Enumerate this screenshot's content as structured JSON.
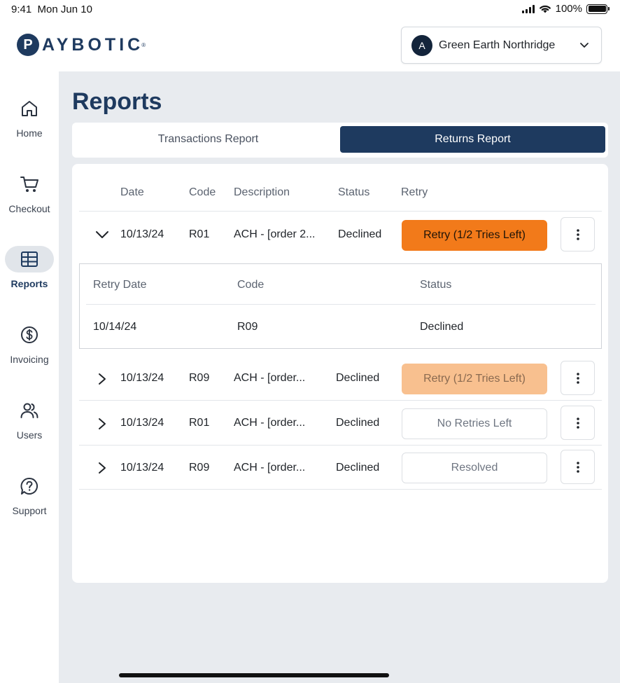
{
  "status_bar": {
    "time": "9:41",
    "date": "Mon Jun 10",
    "battery": "100%"
  },
  "brand": {
    "mark": "P",
    "name": "AYBOTIC",
    "reg": "®"
  },
  "store": {
    "avatar_letter": "A",
    "name": "Green Earth Northridge"
  },
  "sidebar": {
    "items": [
      {
        "label": "Home",
        "icon": "home-icon",
        "active": false
      },
      {
        "label": "Checkout",
        "icon": "cart-icon",
        "active": false
      },
      {
        "label": "Reports",
        "icon": "table-icon",
        "active": true
      },
      {
        "label": "Invoicing",
        "icon": "dollar-circle-icon",
        "active": false
      },
      {
        "label": "Users",
        "icon": "users-icon",
        "active": false
      },
      {
        "label": "Support",
        "icon": "help-bubble-icon",
        "active": false
      }
    ]
  },
  "page": {
    "title": "Reports"
  },
  "tabs": [
    {
      "label": "Transactions Report",
      "active": false
    },
    {
      "label": "Returns Report",
      "active": true
    }
  ],
  "table": {
    "headers": {
      "date": "Date",
      "code": "Code",
      "description": "Description",
      "status": "Status",
      "retry": "Retry"
    },
    "rows": [
      {
        "date": "10/13/24",
        "code": "R01",
        "description": "ACH - [order 2...",
        "status": "Declined",
        "retry": "Retry (1/2 Tries Left)",
        "expanded": true
      },
      {
        "date": "10/13/24",
        "code": "R09",
        "description": "ACH - [order...",
        "status": "Declined",
        "retry": "Retry (1/2 Tries Left)",
        "expanded": false
      },
      {
        "date": "10/13/24",
        "code": "R01",
        "description": "ACH - [order...",
        "status": "Declined",
        "retry": "No Retries Left",
        "expanded": false
      },
      {
        "date": "10/13/24",
        "code": "R09",
        "description": "ACH - [order...",
        "status": "Declined",
        "retry": "Resolved",
        "expanded": false
      }
    ],
    "retry_detail": {
      "headers": {
        "date": "Retry Date",
        "code": "Code",
        "status": "Status"
      },
      "rows": [
        {
          "date": "10/14/24",
          "code": "R09",
          "status": "Declined"
        }
      ]
    }
  },
  "colors": {
    "brand": "#1e3a5f",
    "accent": "#f27a1a",
    "accent_faded": "#f8c08f"
  }
}
